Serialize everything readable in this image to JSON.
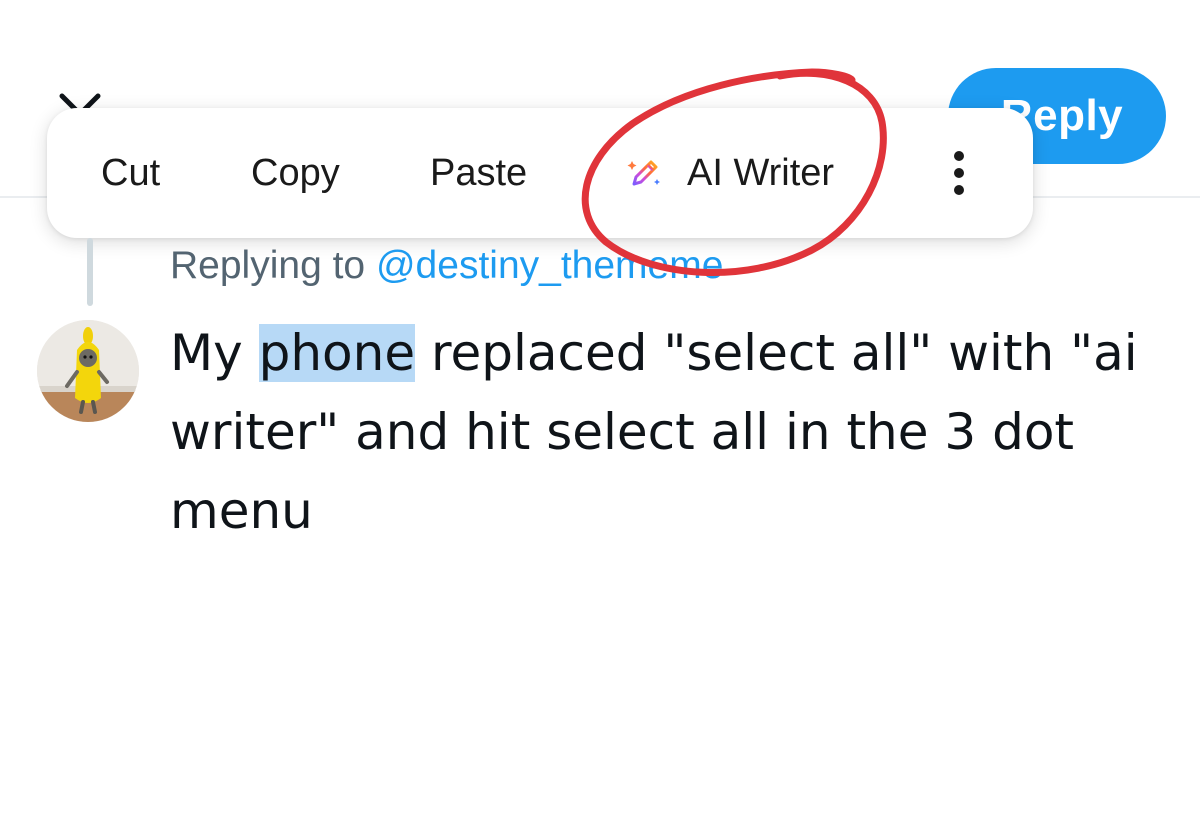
{
  "header": {
    "close_icon": "close-icon",
    "reply_label": "Reply",
    "reply_color": "#1d9bf0"
  },
  "context_menu": {
    "items": [
      {
        "label": "Cut"
      },
      {
        "label": "Copy"
      },
      {
        "label": "Paste"
      },
      {
        "label": "AI Writer",
        "icon": "ai-pen-sparkle-icon"
      },
      {
        "label": "",
        "icon": "more-vertical-icon"
      }
    ]
  },
  "annotation": {
    "shape": "hand-drawn-circle",
    "color": "#e0343a",
    "target": "AI Writer"
  },
  "reply": {
    "replying_prefix": "Replying to",
    "replying_handle": "@destiny_thememe",
    "text_before": "My ",
    "selected_word": "phone",
    "text_after": " replaced \"select all\" with \"ai writer\" and hit select all in the 3 dot menu",
    "highlight_color": "#b7d9f6",
    "avatar_icon": "banana-cat-avatar"
  }
}
